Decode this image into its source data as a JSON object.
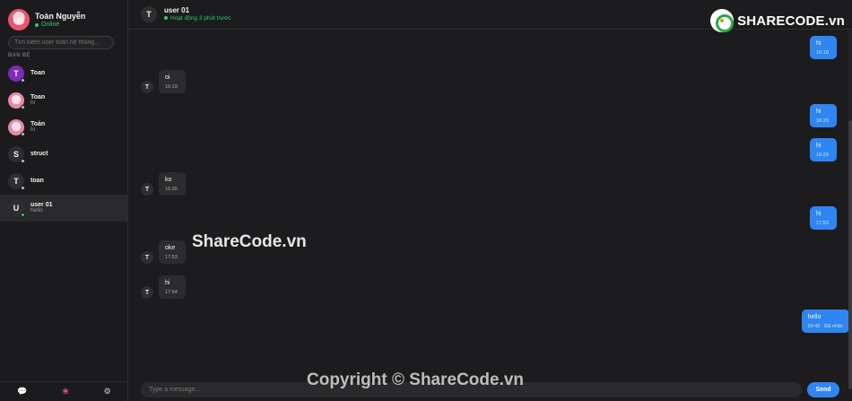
{
  "me": {
    "name": "Toàn Nguyễn",
    "status": "Online"
  },
  "search": {
    "placeholder": "Tìm kiếm user toàn hệ thống..."
  },
  "section_label": "BẠN BÈ",
  "contacts": [
    {
      "initial": "T",
      "name": "Toan",
      "last": "",
      "avatar": "letter-purple",
      "online": false,
      "active": false
    },
    {
      "initial": "",
      "name": "Toan",
      "last": "hi",
      "avatar": "anime",
      "online": false,
      "active": false
    },
    {
      "initial": "",
      "name": "Toàn",
      "last": "hi",
      "avatar": "anime",
      "online": false,
      "active": false
    },
    {
      "initial": "S",
      "name": "struct",
      "last": "",
      "avatar": "letter",
      "online": false,
      "active": false
    },
    {
      "initial": "T",
      "name": "toan",
      "last": "",
      "avatar": "letter",
      "online": false,
      "active": false
    },
    {
      "initial": "U",
      "name": "user 01",
      "last": "hello",
      "avatar": "letter",
      "online": true,
      "active": true
    }
  ],
  "chat_header": {
    "initial": "T",
    "name": "user 01",
    "status": "Hoạt động 3 phút trước"
  },
  "messages": [
    {
      "side": "out",
      "text": "hi",
      "time": "16:18"
    },
    {
      "side": "in",
      "initial": "T",
      "text": "oi",
      "time": "16:19"
    },
    {
      "side": "out",
      "text": "hi",
      "time": "16:29"
    },
    {
      "side": "out",
      "text": "hi",
      "time": "16:29"
    },
    {
      "side": "in",
      "initial": "T",
      "text": "ko",
      "time": "16:30"
    },
    {
      "side": "out",
      "text": "hi",
      "time": "17:53"
    },
    {
      "side": "in",
      "initial": "T",
      "text": "oke",
      "time": "17:53"
    },
    {
      "side": "in",
      "initial": "T",
      "text": "hi",
      "time": "17:54"
    },
    {
      "side": "out",
      "text": "hello",
      "time": "20:42 · Đã nhận"
    }
  ],
  "composer": {
    "placeholder": "Type a message...",
    "send_label": "Send"
  },
  "bottom_bar": {
    "icons": [
      "chat-icon",
      "brain-icon",
      "gear-icon"
    ]
  },
  "watermark": {
    "middle": "ShareCode.vn",
    "copyright": "Copyright © ShareCode.vn",
    "logo_main": "SHARECODE",
    "logo_suffix": ".vn"
  },
  "colors": {
    "accent": "#2f86f0",
    "online": "#2ecc71",
    "background": "#1c1c1e"
  }
}
